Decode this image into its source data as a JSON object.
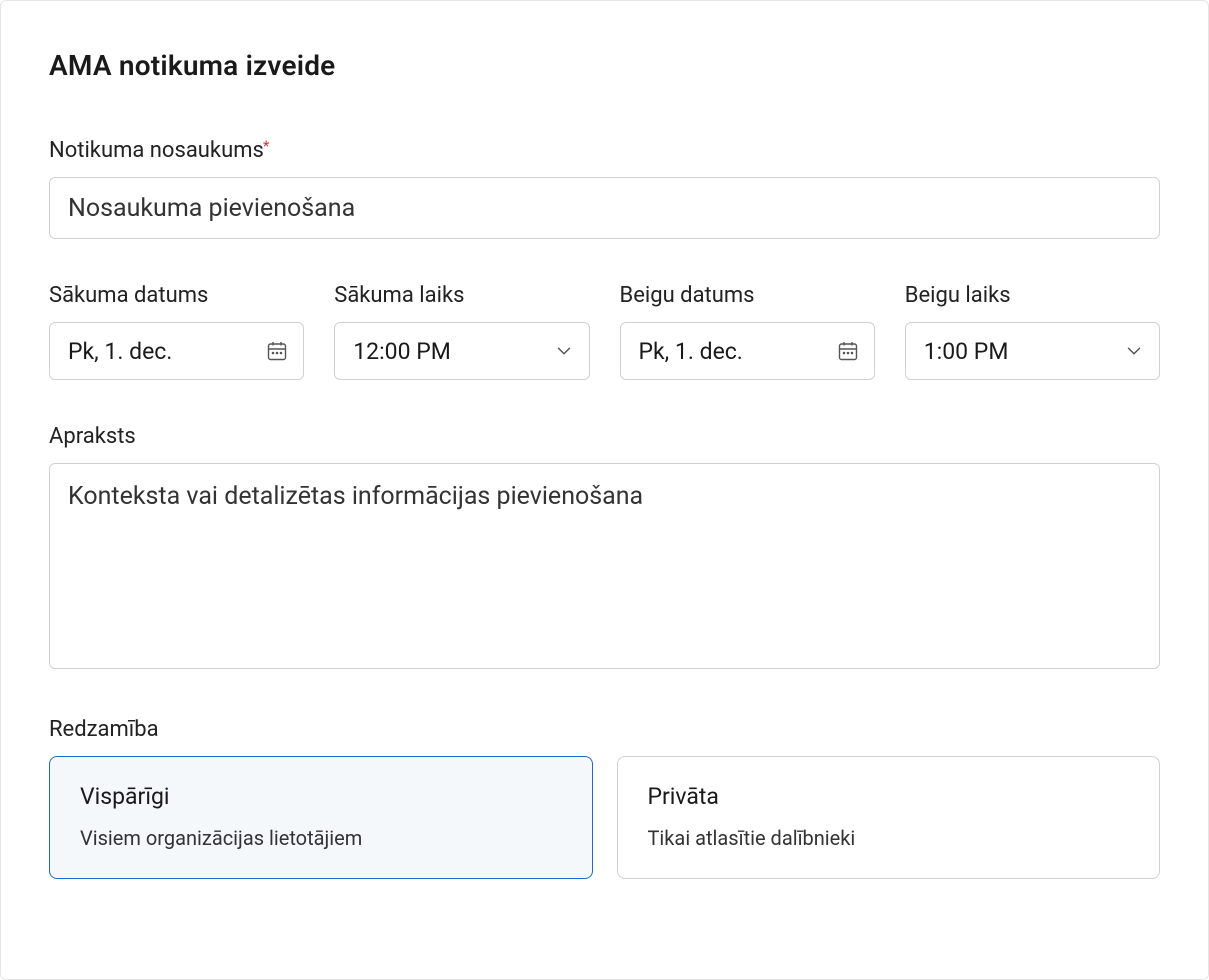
{
  "page_title": "AMA notikuma izveide",
  "event_name": {
    "label": "Notikuma nosaukums",
    "required": true,
    "placeholder": "Nosaukuma pievienošana"
  },
  "start_date": {
    "label": "Sākuma datums",
    "value": "Pk, 1. dec."
  },
  "start_time": {
    "label": "Sākuma laiks",
    "value": "12:00 PM"
  },
  "end_date": {
    "label": "Beigu datums",
    "value": "Pk, 1. dec."
  },
  "end_time": {
    "label": "Beigu laiks",
    "value": "1:00 PM"
  },
  "description": {
    "label": "Apraksts",
    "placeholder": "Konteksta vai detalizētas informācijas pievienošana"
  },
  "visibility": {
    "label": "Redzamība",
    "options": [
      {
        "title": "Vispārīgi",
        "desc": "Visiem organizācijas lietotājiem",
        "selected": true
      },
      {
        "title": "Privāta",
        "desc": "Tikai atlasītie dalībnieki",
        "selected": false
      }
    ]
  }
}
